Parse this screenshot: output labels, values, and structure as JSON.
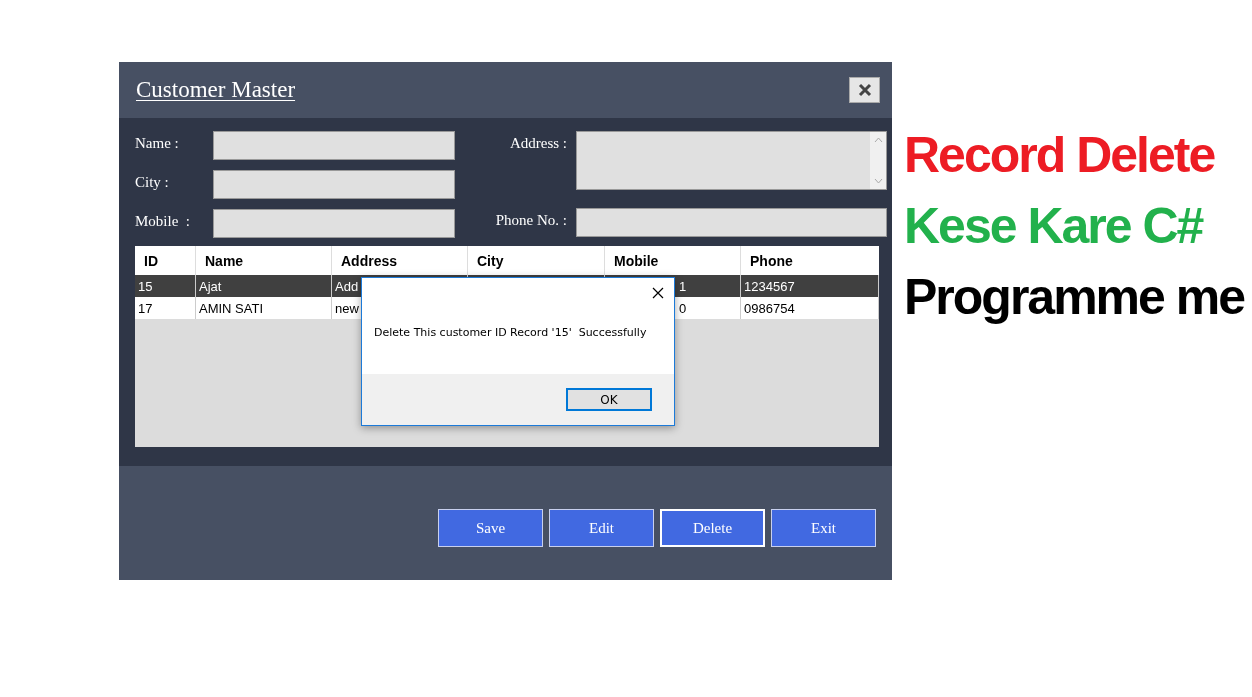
{
  "window": {
    "title": "Customer Master"
  },
  "fields": [
    {
      "label": "Name :",
      "kind": "text"
    },
    {
      "label": "Address :",
      "kind": "multiline"
    },
    {
      "label": "City :",
      "kind": "text"
    },
    {
      "label": "Mobile  :",
      "kind": "text"
    },
    {
      "label": "Phone No. :",
      "kind": "text"
    }
  ],
  "table": {
    "columns": [
      "ID",
      "Name",
      "Address",
      "City",
      "Mobile",
      "Phone"
    ],
    "rows": [
      {
        "selected": true,
        "cells": {
          "id": "15",
          "name": "Ajat",
          "address": "Add",
          "mobile": "1",
          "phone": "1234567"
        }
      },
      {
        "selected": false,
        "cells": {
          "id": "17",
          "name": "AMIN SATI",
          "address": "new",
          "mobile": "0",
          "phone": "0986754"
        }
      }
    ]
  },
  "dialog": {
    "message": "Delete This customer ID Record '15'  Successfully",
    "button": "OK"
  },
  "buttons": [
    {
      "label": "Save",
      "focused": false
    },
    {
      "label": "Edit",
      "focused": false
    },
    {
      "label": "Delete",
      "focused": true
    },
    {
      "label": "Exit",
      "focused": false
    }
  ],
  "caption": [
    {
      "text": "Record Delete",
      "color": "#ed1c24"
    },
    {
      "text": "Kese Kare C#",
      "color": "#22b14c"
    },
    {
      "text": "Programme me",
      "color": "#000000"
    }
  ]
}
